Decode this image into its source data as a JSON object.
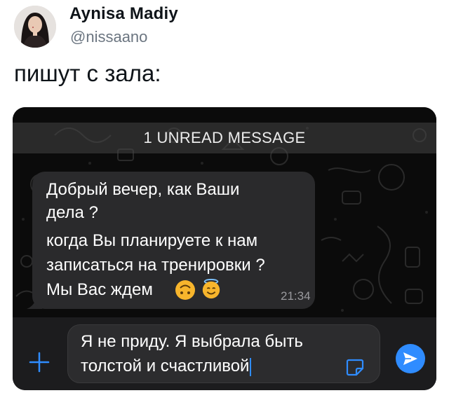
{
  "tweet": {
    "display_name": "Aynisa Madiy",
    "handle": "@nissaano",
    "text": "пишут с зала:",
    "avatar_icon": "profile-photo"
  },
  "chat": {
    "unread_banner": "1 UNREAD MESSAGE",
    "incoming_message": {
      "lines": [
        "Добрый вечер, как Ваши",
        "дела ?",
        "когда Вы планируете к нам",
        "записаться на тренировки ?",
        "Мы Вас ждем"
      ],
      "emojis": [
        "upside-down-face",
        "smiling-face-with-halo"
      ],
      "time": "21:34"
    },
    "composer": {
      "draft_lines": [
        "Я не приду. Я выбрала быть",
        "толстой и счастливой"
      ],
      "plus_icon": "plus-icon",
      "sticker_icon": "sticker-icon",
      "send_icon": "send-icon"
    },
    "colors": {
      "accent": "#2f8cff",
      "bubble": "#2a2a2c",
      "background": "#0a0a0a"
    }
  }
}
